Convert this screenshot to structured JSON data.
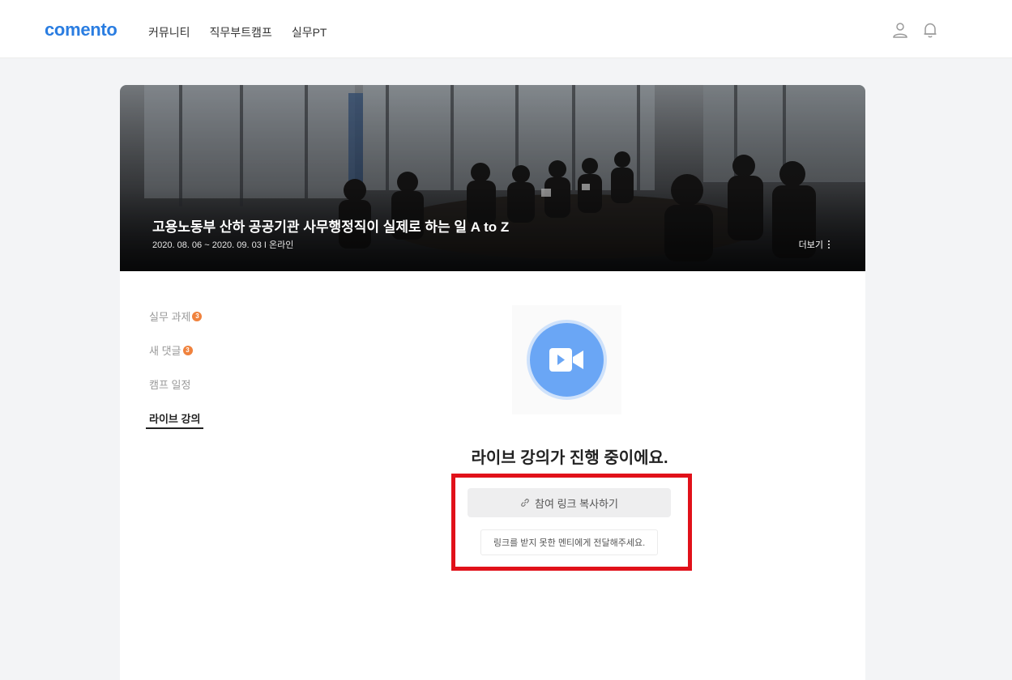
{
  "header": {
    "logo": "comento",
    "nav": [
      "커뮤니티",
      "직무부트캠프",
      "실무PT"
    ],
    "icons": [
      "user-icon",
      "bell-icon"
    ]
  },
  "banner": {
    "title": "고용노동부 산하 공공기관 사무행정직이 실제로 하는 일 A to Z",
    "subtitle": "2020. 08. 06 ~ 2020. 09. 03 I 온라인",
    "more_label": "더보기"
  },
  "sidebar": {
    "items": [
      {
        "label": "실무 과제",
        "badge": "3"
      },
      {
        "label": "새 댓글",
        "badge": "3"
      },
      {
        "label": "캠프 일정",
        "badge": ""
      },
      {
        "label": "라이브 강의",
        "badge": "",
        "active": true
      }
    ]
  },
  "main": {
    "title": "라이브 강의가 진행 중이에요.",
    "copy_button_label": "참여 링크 복사하기",
    "hint": "링크를 받지 못한 멘티에게 전달해주세요."
  },
  "colors": {
    "brand": "#2a7de1",
    "badge": "#f0823d",
    "video_circle": "#6aa6f5",
    "highlight": "#e1111a"
  }
}
